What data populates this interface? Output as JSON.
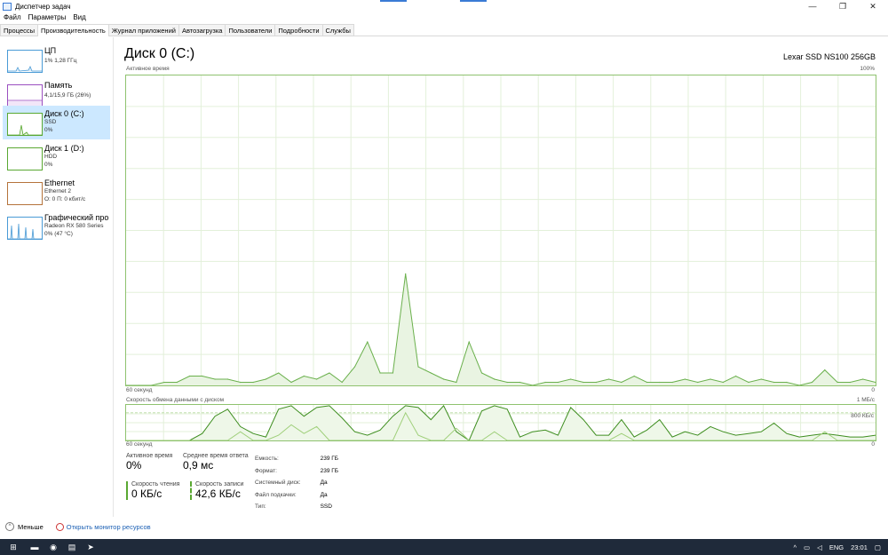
{
  "window": {
    "title": "Диспетчер задач",
    "minimize": "—",
    "maximize": "❐",
    "close": "✕"
  },
  "menu": [
    "Файл",
    "Параметры",
    "Вид"
  ],
  "tabs": [
    "Процессы",
    "Производительность",
    "Журнал приложений",
    "Автозагрузка",
    "Пользователи",
    "Подробности",
    "Службы"
  ],
  "sidebar": [
    {
      "name": "ЦП",
      "line1": "1% 1,28 ГГц",
      "line2": "",
      "color": "#4a9bd6"
    },
    {
      "name": "Память",
      "line1": "4,1/15,9 ГБ (26%)",
      "line2": "",
      "color": "#9b4fc0"
    },
    {
      "name": "Диск 0 (C:)",
      "line1": "SSD",
      "line2": "0%",
      "color": "#5aa832"
    },
    {
      "name": "Диск 1 (D:)",
      "line1": "HDD",
      "line2": "0%",
      "color": "#5aa832"
    },
    {
      "name": "Ethernet",
      "line1": "Ethernet 2",
      "line2": "О: 0 П: 0 кбит/с",
      "color": "#b5733b"
    },
    {
      "name": "Графический про",
      "line1": "Radeon RX 580 Series",
      "line2": "0% (47 °C)",
      "color": "#4a9bd6"
    }
  ],
  "main": {
    "title": "Диск 0 (C:)",
    "device": "Lexar SSD NS100 256GB",
    "chart1_label": "Активное время",
    "chart1_max": "100%",
    "chart1_time": "60 секунд",
    "chart1_min": "0",
    "chart2_label": "Скорость обмена данными с диском",
    "chart2_max": "1 МБ/с",
    "chart2_mid": "800 КБ/с",
    "chart2_time": "60 секунд",
    "chart2_min": "0"
  },
  "stats": {
    "active_label": "Активное время",
    "active_value": "0%",
    "response_label": "Среднее время ответа",
    "response_value": "0,9 мс",
    "read_label": "Скорость чтения",
    "read_value": "0 КБ/с",
    "write_label": "Скорость записи",
    "write_value": "42,6 КБ/с"
  },
  "properties": [
    {
      "k": "Емкость:",
      "v": "239 ГБ"
    },
    {
      "k": "Формат:",
      "v": "239 ГБ"
    },
    {
      "k": "Системный диск:",
      "v": "Да"
    },
    {
      "k": "Файл подкачки:",
      "v": "Да"
    },
    {
      "k": "Тип:",
      "v": "SSD"
    }
  ],
  "footer": {
    "less": "Меньше",
    "monitor": "Открыть монитор ресурсов"
  },
  "taskbar": {
    "lang": "ENG",
    "time": "23:01"
  },
  "chart_data": [
    {
      "type": "area",
      "ylim": [
        0,
        100
      ],
      "x": [
        0,
        1,
        2,
        3,
        4,
        5,
        6,
        7,
        8,
        9,
        10,
        11,
        12,
        13,
        14,
        15,
        16,
        17,
        18,
        19,
        20,
        21,
        22,
        23,
        24,
        25,
        26,
        27,
        28,
        29,
        30,
        31,
        32,
        33,
        34,
        35,
        36,
        37,
        38,
        39,
        40,
        41,
        42,
        43,
        44,
        45,
        46,
        47,
        48,
        49,
        50,
        51,
        52,
        53,
        54,
        55,
        56,
        57,
        58,
        59
      ],
      "values": [
        0,
        0,
        0,
        1,
        1,
        3,
        3,
        2,
        2,
        1,
        1,
        2,
        4,
        1,
        3,
        2,
        4,
        1,
        6,
        14,
        4,
        4,
        36,
        6,
        4,
        2,
        1,
        14,
        4,
        2,
        1,
        1,
        0,
        1,
        1,
        2,
        1,
        1,
        2,
        1,
        3,
        1,
        1,
        1,
        2,
        1,
        2,
        1,
        3,
        1,
        2,
        1,
        1,
        0,
        1,
        5,
        1,
        1,
        2,
        1
      ],
      "colors": {
        "stroke": "#6ab04c",
        "fill": "#e9f4e2"
      }
    },
    {
      "type": "line",
      "ylim": [
        0,
        1024
      ],
      "series": [
        {
          "values": [
            0,
            0,
            0,
            0,
            0,
            0,
            200,
            700,
            900,
            400,
            200,
            100,
            900,
            1000,
            700,
            950,
            1000,
            650,
            250,
            150,
            300,
            700,
            1000,
            950,
            600,
            1000,
            250,
            0,
            850,
            1000,
            900,
            100,
            250,
            300,
            150,
            950,
            600,
            150,
            150,
            600,
            100,
            300,
            600,
            100,
            250,
            150,
            400,
            250,
            150,
            200,
            250,
            500,
            200,
            100,
            150,
            200,
            150,
            100,
            100,
            150
          ],
          "colors": {
            "stroke": "#3e8e1f"
          }
        },
        {
          "values": [
            0,
            0,
            0,
            0,
            0,
            0,
            0,
            0,
            0,
            250,
            0,
            0,
            150,
            450,
            200,
            400,
            0,
            0,
            0,
            0,
            0,
            0,
            800,
            150,
            0,
            0,
            350,
            0,
            0,
            250,
            0,
            0,
            0,
            0,
            0,
            0,
            0,
            0,
            0,
            200,
            0,
            0,
            0,
            0,
            0,
            0,
            0,
            0,
            0,
            0,
            0,
            0,
            0,
            0,
            0,
            250,
            0,
            0,
            0,
            0
          ],
          "colors": {
            "stroke": "#9fcf7a"
          }
        }
      ]
    }
  ]
}
